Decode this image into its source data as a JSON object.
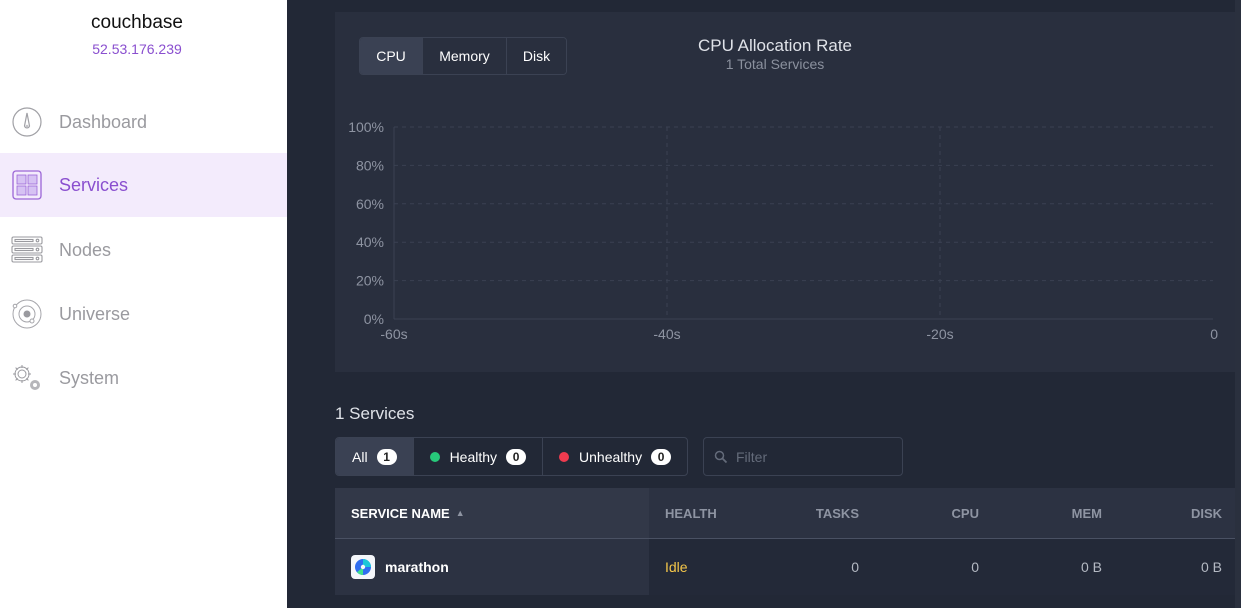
{
  "sidebar": {
    "cluster_name": "couchbase",
    "cluster_ip": "52.53.176.239",
    "items": [
      {
        "label": "Dashboard",
        "icon": "dashboard-gauge-icon",
        "active": false
      },
      {
        "label": "Services",
        "icon": "services-grid-icon",
        "active": true
      },
      {
        "label": "Nodes",
        "icon": "nodes-server-icon",
        "active": false
      },
      {
        "label": "Universe",
        "icon": "universe-orbit-icon",
        "active": false
      },
      {
        "label": "System",
        "icon": "system-gears-icon",
        "active": false
      }
    ]
  },
  "chart_panel": {
    "tabs": [
      {
        "label": "CPU",
        "active": true
      },
      {
        "label": "Memory",
        "active": false
      },
      {
        "label": "Disk",
        "active": false
      }
    ]
  },
  "chart_data": {
    "type": "line",
    "title": "CPU Allocation Rate",
    "subtitle": "1 Total Services",
    "xlabel": "",
    "ylabel": "",
    "x_ticks": [
      "-60s",
      "-40s",
      "-20s",
      "0"
    ],
    "x_values": [
      -60,
      -40,
      -20,
      0
    ],
    "xlim": [
      -60,
      0
    ],
    "y_ticks": [
      "0%",
      "20%",
      "40%",
      "60%",
      "80%",
      "100%"
    ],
    "y_values": [
      0,
      20,
      40,
      60,
      80,
      100
    ],
    "ylim": [
      0,
      100
    ],
    "grid": true,
    "series": []
  },
  "services": {
    "title": "1 Services",
    "filters": [
      {
        "label": "All",
        "count": "1",
        "active": true,
        "dot_color": null
      },
      {
        "label": "Healthy",
        "count": "0",
        "active": false,
        "dot_color": "#27c97a"
      },
      {
        "label": "Unhealthy",
        "count": "0",
        "active": false,
        "dot_color": "#ef3b4f"
      }
    ],
    "filter_placeholder": "Filter",
    "filter_value": "",
    "table": {
      "columns": {
        "name": "SERVICE NAME",
        "health": "HEALTH",
        "tasks": "TASKS",
        "cpu": "CPU",
        "mem": "MEM",
        "disk": "DISK"
      },
      "sort_indicator": "▲",
      "rows": [
        {
          "name": "marathon",
          "health": "Idle",
          "tasks": "0",
          "cpu": "0",
          "mem": "0 B",
          "disk": "0 B",
          "health_color": "#f5c74a"
        }
      ]
    }
  }
}
